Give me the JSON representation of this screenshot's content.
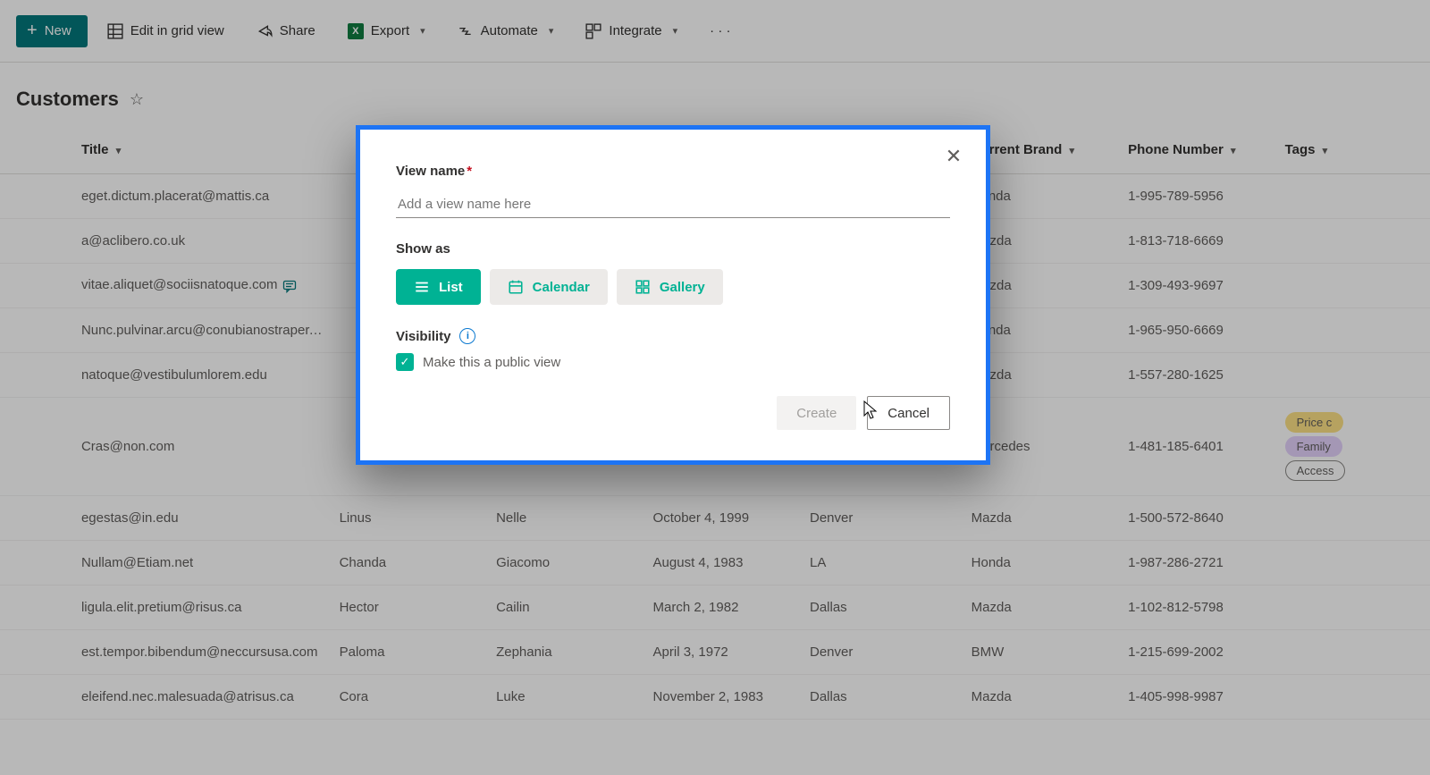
{
  "toolbar": {
    "new": "New",
    "edit_grid": "Edit in grid view",
    "share": "Share",
    "export": "Export",
    "automate": "Automate",
    "integrate": "Integrate"
  },
  "page": {
    "title": "Customers"
  },
  "columns": {
    "title": "Title",
    "first": "",
    "last": "",
    "dob": "",
    "city": "",
    "brand": "Current Brand",
    "phone": "Phone Number",
    "tags": "Tags"
  },
  "rows": [
    {
      "title": "eget.dictum.placerat@mattis.ca",
      "first": "",
      "last": "",
      "dob": "",
      "city": "",
      "brand": "Honda",
      "phone": "1-995-789-5956",
      "tags": []
    },
    {
      "title": "a@aclibero.co.uk",
      "first": "",
      "last": "",
      "dob": "",
      "city": "",
      "brand": "Mazda",
      "phone": "1-813-718-6669",
      "tags": []
    },
    {
      "title": "vitae.aliquet@sociisnatoque.com",
      "first": "",
      "last": "",
      "dob": "",
      "city": "",
      "brand": "Mazda",
      "phone": "1-309-493-9697",
      "tags": [],
      "hasComment": true
    },
    {
      "title": "Nunc.pulvinar.arcu@conubianostraper.edu",
      "first": "",
      "last": "",
      "dob": "",
      "city": "",
      "brand": "Honda",
      "phone": "1-965-950-6669",
      "tags": []
    },
    {
      "title": "natoque@vestibulumlorem.edu",
      "first": "",
      "last": "",
      "dob": "",
      "city": "",
      "brand": "Mazda",
      "phone": "1-557-280-1625",
      "tags": []
    },
    {
      "title": "Cras@non.com",
      "first": "",
      "last": "",
      "dob": "",
      "city": "",
      "brand": "Mercedes",
      "phone": "1-481-185-6401",
      "tags": [
        {
          "text": "Price c",
          "kind": "yellow"
        },
        {
          "text": "Family",
          "kind": "purple"
        },
        {
          "text": "Access",
          "kind": "outline"
        }
      ]
    },
    {
      "title": "egestas@in.edu",
      "first": "Linus",
      "last": "Nelle",
      "dob": "October 4, 1999",
      "city": "Denver",
      "brand": "Mazda",
      "phone": "1-500-572-8640",
      "tags": []
    },
    {
      "title": "Nullam@Etiam.net",
      "first": "Chanda",
      "last": "Giacomo",
      "dob": "August 4, 1983",
      "city": "LA",
      "brand": "Honda",
      "phone": "1-987-286-2721",
      "tags": []
    },
    {
      "title": "ligula.elit.pretium@risus.ca",
      "first": "Hector",
      "last": "Cailin",
      "dob": "March 2, 1982",
      "city": "Dallas",
      "brand": "Mazda",
      "phone": "1-102-812-5798",
      "tags": []
    },
    {
      "title": "est.tempor.bibendum@neccursusa.com",
      "first": "Paloma",
      "last": "Zephania",
      "dob": "April 3, 1972",
      "city": "Denver",
      "brand": "BMW",
      "phone": "1-215-699-2002",
      "tags": []
    },
    {
      "title": "eleifend.nec.malesuada@atrisus.ca",
      "first": "Cora",
      "last": "Luke",
      "dob": "November 2, 1983",
      "city": "Dallas",
      "brand": "Mazda",
      "phone": "1-405-998-9987",
      "tags": []
    }
  ],
  "modal": {
    "view_name_label": "View name",
    "view_name_placeholder": "Add a view name here",
    "show_as_label": "Show as",
    "options": {
      "list": "List",
      "calendar": "Calendar",
      "gallery": "Gallery"
    },
    "visibility_label": "Visibility",
    "public_label": "Make this a public view",
    "create": "Create",
    "cancel": "Cancel"
  }
}
